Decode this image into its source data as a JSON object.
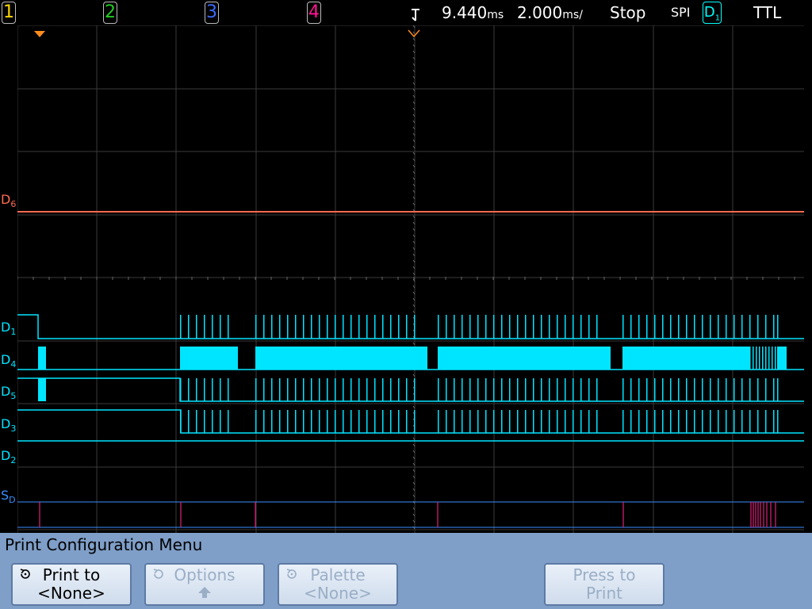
{
  "topbar": {
    "channels": [
      {
        "label": "1",
        "color": "#ffd700"
      },
      {
        "label": "2",
        "color": "#22cc22"
      },
      {
        "label": "3",
        "color": "#3a6bff"
      },
      {
        "label": "4",
        "color": "#ff1493"
      }
    ],
    "trigger_arrow": "trigger-arrow-icon",
    "delay_value": "9.440",
    "delay_unit": "ms",
    "timebase_value": "2.000",
    "timebase_unit": "ms/",
    "run_state": "Stop",
    "decode_mode": "SPI",
    "source_label": "D",
    "source_sub": "1",
    "threshold": "TTL"
  },
  "channel_labels": [
    {
      "main": "D",
      "sub": "6",
      "color": "#ff6a50"
    },
    {
      "main": "D",
      "sub": "1",
      "color": "#00e5ff"
    },
    {
      "main": "D",
      "sub": "4",
      "color": "#00e5ff"
    },
    {
      "main": "D",
      "sub": "5",
      "color": "#00e5ff"
    },
    {
      "main": "D",
      "sub": "3",
      "color": "#00e5ff"
    },
    {
      "main": "D",
      "sub": "2",
      "color": "#00e5ff"
    },
    {
      "main": "S",
      "sub": "D",
      "color": "#3a8fff"
    }
  ],
  "menu": {
    "title": "Print Configuration Menu",
    "softkeys": [
      {
        "line1": "Print to",
        "line2": "<None>",
        "enabled": true
      },
      {
        "line1": "Options",
        "line2": "",
        "enabled": false
      },
      {
        "line1": "Palette",
        "line2": "<None>",
        "enabled": false
      },
      {
        "line1": "Press to",
        "line2": "Print",
        "enabled": false
      }
    ]
  },
  "colors": {
    "accent_cyan": "#00e5ff",
    "d6_trace": "#ff6a50",
    "spi_bus": "#3a8fff",
    "spi_marker": "#e0207a",
    "menu_bg": "#7f9fc8"
  }
}
